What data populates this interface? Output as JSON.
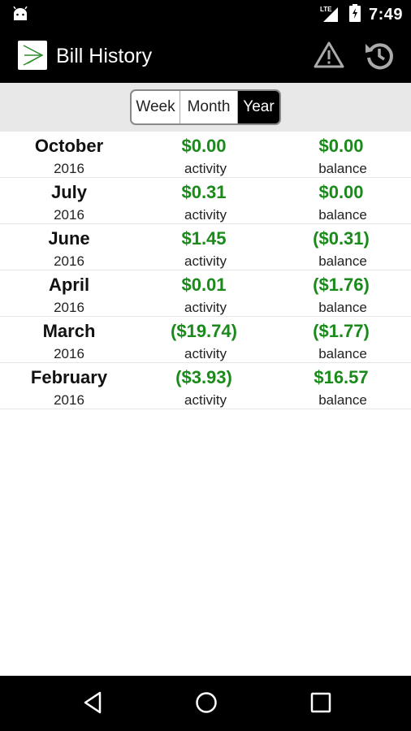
{
  "status_bar": {
    "network": "LTE",
    "time": "7:49"
  },
  "app_bar": {
    "title": "Bill History",
    "icons": [
      "app-logo-icon",
      "warning-icon",
      "refresh-icon"
    ]
  },
  "segmented_control": {
    "options": [
      "Week",
      "Month",
      "Year"
    ],
    "selected": "Year"
  },
  "rows": [
    {
      "month": "October",
      "year": "2016",
      "activity": "$0.00",
      "activity_label": "activity",
      "balance": "$0.00",
      "balance_label": "balance"
    },
    {
      "month": "July",
      "year": "2016",
      "activity": "$0.31",
      "activity_label": "activity",
      "balance": "$0.00",
      "balance_label": "balance"
    },
    {
      "month": "June",
      "year": "2016",
      "activity": "$1.45",
      "activity_label": "activity",
      "balance": "($0.31)",
      "balance_label": "balance"
    },
    {
      "month": "April",
      "year": "2016",
      "activity": "$0.01",
      "activity_label": "activity",
      "balance": "($1.76)",
      "balance_label": "balance"
    },
    {
      "month": "March",
      "year": "2016",
      "activity": "($19.74)",
      "activity_label": "activity",
      "balance": "($1.77)",
      "balance_label": "balance"
    },
    {
      "month": "February",
      "year": "2016",
      "activity": "($3.93)",
      "activity_label": "activity",
      "balance": "$16.57",
      "balance_label": "balance"
    }
  ],
  "colors": {
    "amount": "#1a8a1a",
    "bar": "#000000",
    "segment_bar": "#e8e8e8"
  },
  "nav_bar": {
    "icons": [
      "back-icon",
      "home-icon",
      "recents-icon"
    ]
  }
}
